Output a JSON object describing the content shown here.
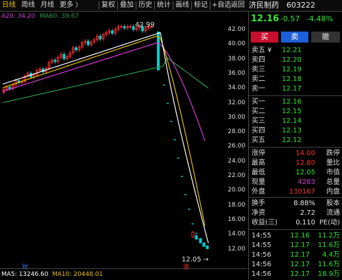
{
  "toolbar": {
    "left_items": [
      "日线",
      "周线",
      "月线",
      "更多"
    ],
    "right_items": [
      "复权",
      "叠加",
      "历史",
      "统计",
      "画线",
      "标记",
      "+自选",
      "返回"
    ],
    "left_arrow": "〉"
  },
  "ma_header": {
    "ma20": "A20: 34.20",
    "ma60": "MA60: 39.67"
  },
  "price_axis": [
    "42.00",
    "40.00",
    "38.00",
    "36.00",
    "34.00",
    "32.00",
    "30.00",
    "28.00",
    "26.00",
    "24.00",
    "22.00",
    "20.00",
    "18.00",
    "16.00",
    "14.00",
    "12.00"
  ],
  "annotations": {
    "high_label": "42.99",
    "low_label": "12.05",
    "day_mark": "财",
    "bottom_mark": "涨"
  },
  "bottom_bar": {
    "ma5": "MA5: 13246.60",
    "ma10": "MA10: 20448.01"
  },
  "stock": {
    "name": "济民制药",
    "code": "603222",
    "price": "12.16",
    "change": "-0.57",
    "change_pct": "-4.48%"
  },
  "buttons": {
    "buy": "买",
    "sell": "卖",
    "cancel": "撤"
  },
  "asks": [
    {
      "label": "卖五 ¥",
      "price": "12.21",
      "volume": ""
    },
    {
      "label": "卖四",
      "price": "12.20",
      "volume": ""
    },
    {
      "label": "卖三",
      "price": "12.19",
      "volume": ""
    },
    {
      "label": "卖二",
      "price": "12.18",
      "volume": ""
    },
    {
      "label": "卖一",
      "price": "12.17",
      "volume": ""
    }
  ],
  "bids": [
    {
      "label": "买一",
      "price": "12.16",
      "volume": ""
    },
    {
      "label": "买二",
      "price": "12.15",
      "volume": ""
    },
    {
      "label": "买三",
      "price": "12.14",
      "volume": ""
    },
    {
      "label": "买四",
      "price": "12.13",
      "volume": ""
    },
    {
      "label": "买五",
      "price": "12.12",
      "volume": ""
    }
  ],
  "stats": [
    {
      "l1": "涨停",
      "v1": "14.00",
      "v1c": "red",
      "l2": "跌停"
    },
    {
      "l1": "最高",
      "v1": "12.80",
      "v1c": "red",
      "l2": "量比"
    },
    {
      "l1": "最低",
      "v1": "12.05",
      "v1c": "green",
      "l2": "市值"
    },
    {
      "l1": "现量",
      "v1": "4283",
      "v1c": "purple",
      "l2": "总量"
    },
    {
      "l1": "外盘",
      "v1": "130167",
      "v1c": "red",
      "l2": "内盘"
    },
    {
      "l1": "换手",
      "v1": "8.88%",
      "v1c": "white",
      "l2": "股本"
    },
    {
      "l1": "净资",
      "v1": "2.72",
      "v1c": "white",
      "l2": "流通"
    },
    {
      "l1": "收益(三)",
      "v1": "0.110",
      "v1c": "white",
      "l2": "PE(动)"
    }
  ],
  "ticks": [
    {
      "time": "14:55",
      "price": "12.16",
      "vol": "11.2万"
    },
    {
      "time": "14:55",
      "price": "12.17",
      "vol": "11.6万"
    },
    {
      "time": "14:56",
      "price": "12.17",
      "vol": "4.4万"
    },
    {
      "time": "14:56",
      "price": "12.17",
      "vol": "11.6万"
    },
    {
      "time": "14:56",
      "price": "12.17",
      "vol": "18.9万"
    }
  ],
  "colors": {
    "up": "#ff3030",
    "down": "#2ee82e",
    "ma5": "#ffffff",
    "ma10": "#e8c000",
    "ma20": "#d63ad6",
    "ma60": "#2e9e4a",
    "candle_up": "#ff3030",
    "candle_down": "#00d0d0"
  }
}
